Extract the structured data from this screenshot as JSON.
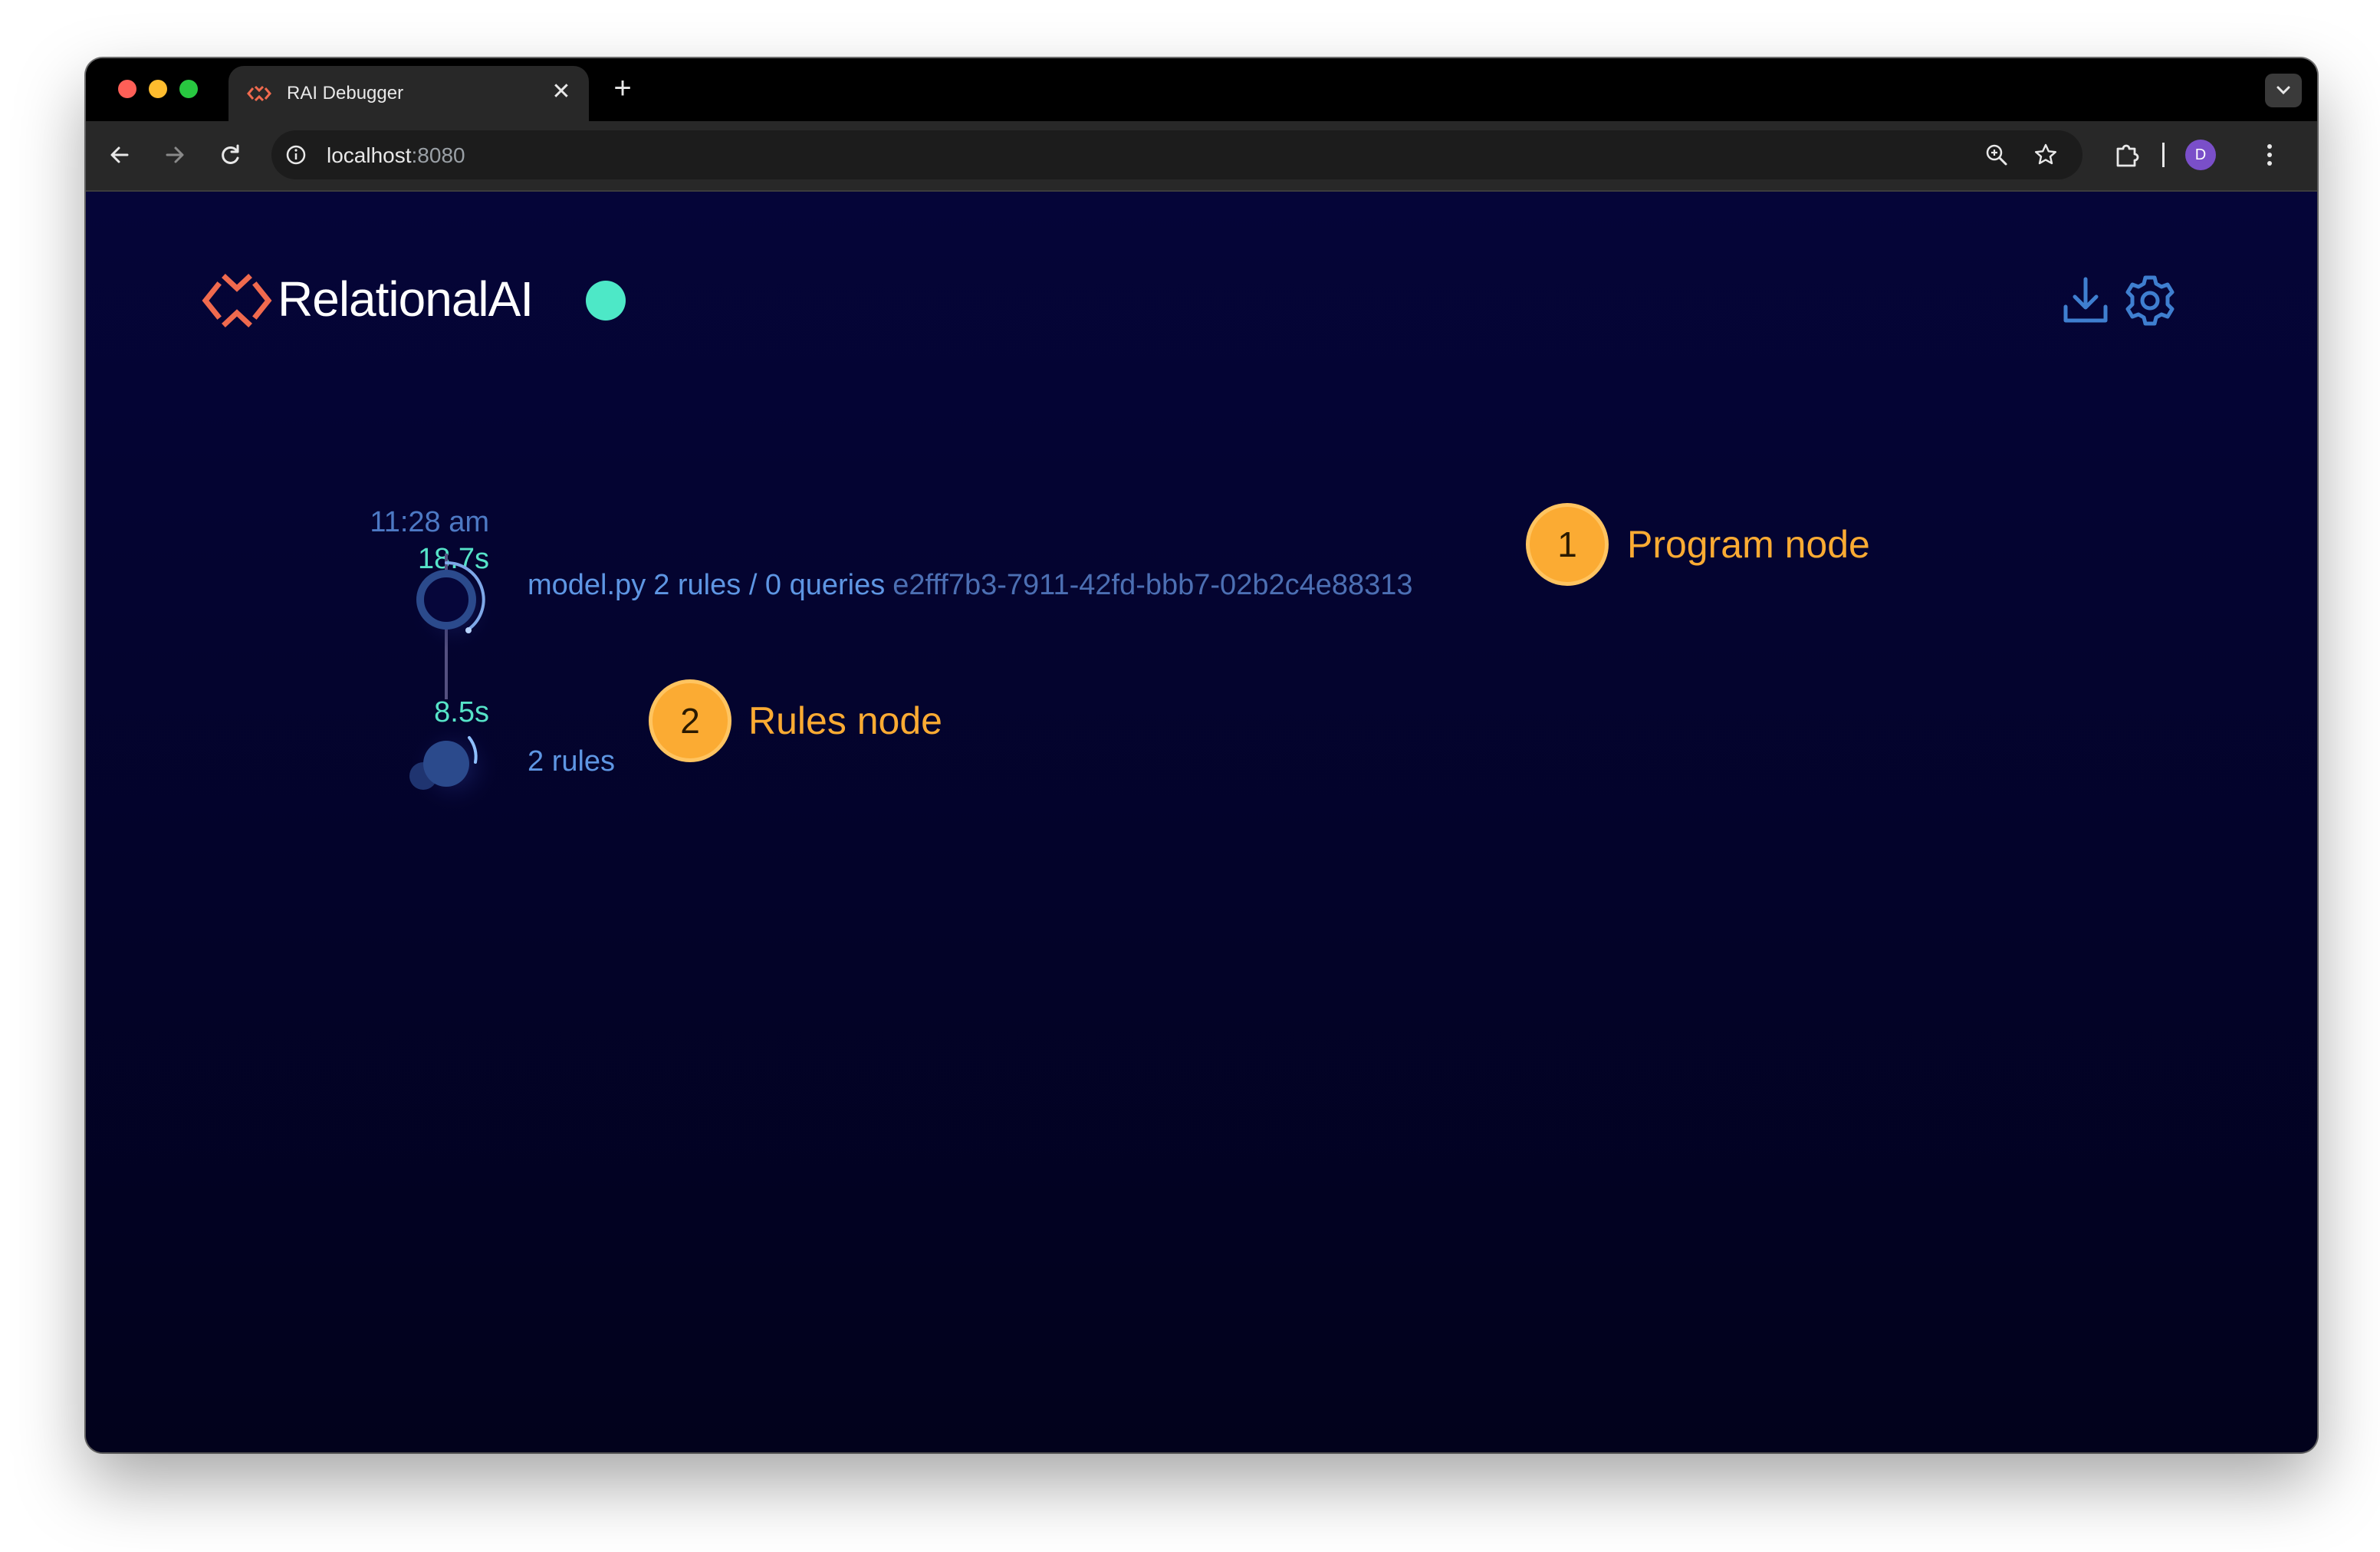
{
  "browser": {
    "tab_title": "RAI Debugger",
    "tab_close_glyph": "✕",
    "new_tab_glyph": "+",
    "url_host": "localhost",
    "url_port": ":8080",
    "avatar_initial": "D",
    "icons": [
      "back-icon",
      "forward-icon",
      "reload-icon",
      "info-icon",
      "zoom-icon",
      "star-icon",
      "extensions-icon",
      "kebab-menu-icon",
      "tab-search-icon"
    ]
  },
  "app": {
    "brand": "RelationalAI",
    "status_color": "#4de8c7",
    "accent_color": "#fbab33",
    "icons": [
      "relationalai-logo-icon",
      "download-icon",
      "gear-icon"
    ]
  },
  "timeline": {
    "program": {
      "time": "11:28 am",
      "duration": "18.7s",
      "name": "model.py",
      "stats": "2 rules / 0 queries",
      "id": "e2fff7b3-7911-42fd-bbb7-02b2c4e88313"
    },
    "rules": {
      "duration": "8.5s",
      "label": "2 rules"
    }
  },
  "annotations": [
    {
      "number": "1",
      "label": "Program node"
    },
    {
      "number": "2",
      "label": "Rules node"
    }
  ]
}
